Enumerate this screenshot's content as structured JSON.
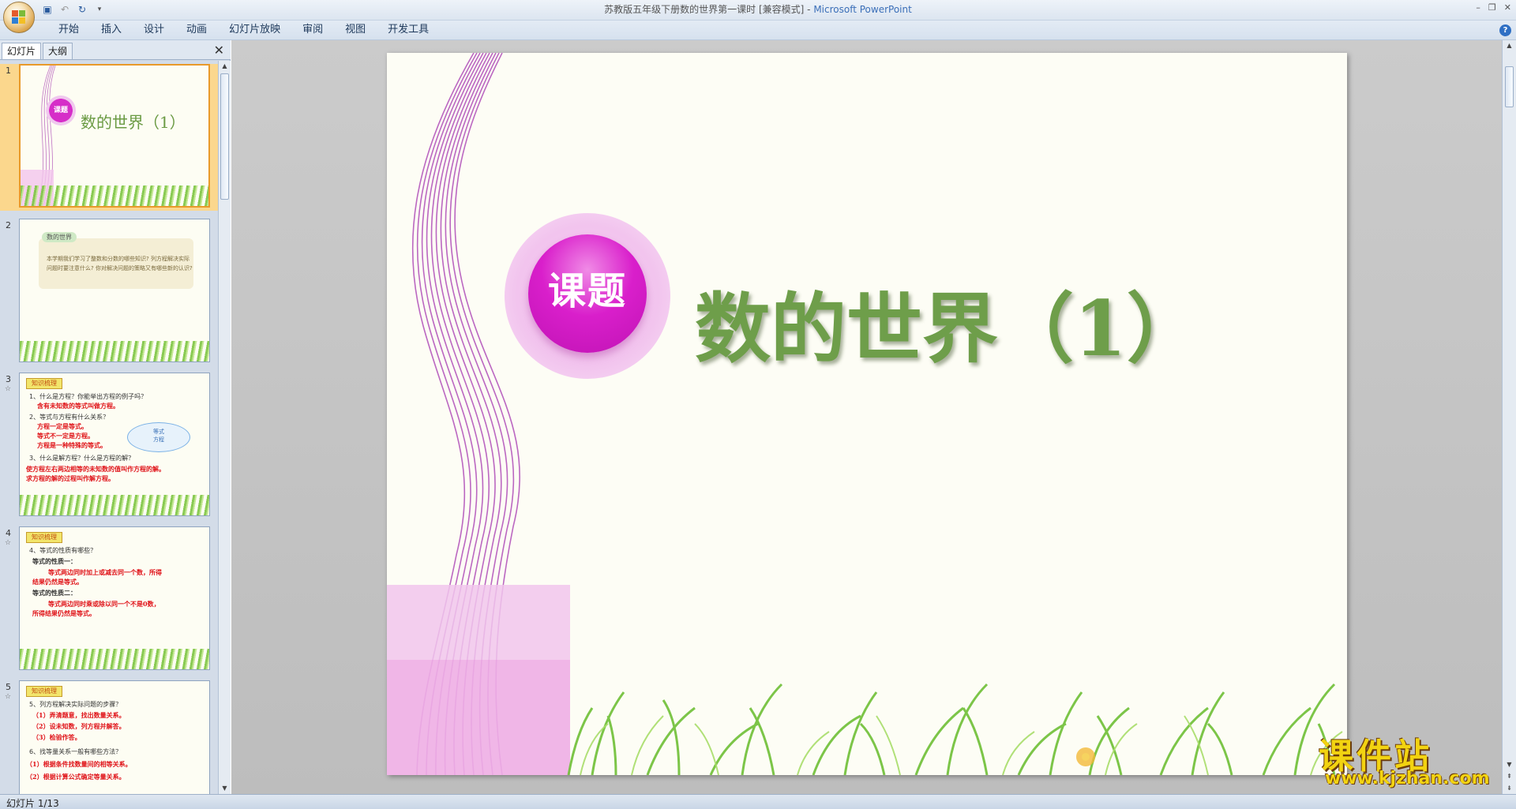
{
  "window": {
    "title": "苏教版五年级下册数的世界第一课时 [兼容模式] - ",
    "app_name": "Microsoft PowerPoint"
  },
  "ribbon": {
    "tabs": [
      "开始",
      "插入",
      "设计",
      "动画",
      "幻灯片放映",
      "审阅",
      "视图",
      "开发工具"
    ]
  },
  "panel": {
    "tab_slides": "幻灯片",
    "tab_outline": "大纲",
    "close": "✕"
  },
  "thumbnails": [
    {
      "num": "1",
      "title": "数的世界（1）",
      "badge": "课题"
    },
    {
      "num": "2",
      "tag": "数的世界",
      "text": "本学期我们学习了整数和分数的哪些知识? 列方程解决实际问题时要注意什么? 你对解决问题的策略又有哪些新的认识?"
    },
    {
      "num": "3",
      "tag": "知识梳理",
      "lines": [
        {
          "t": "1、什么是方程？你能举出方程的例子吗？",
          "red": false
        },
        {
          "t": "含有未知数的等式叫做方程。",
          "red": true
        },
        {
          "t": "2、等式与方程有什么关系？",
          "red": false
        },
        {
          "t": "方程一定是等式。",
          "red": true
        },
        {
          "t": "等式不一定是方程。",
          "red": true
        },
        {
          "t": "方程是一种特殊的等式。",
          "red": true
        },
        {
          "t": "3、什么是解方程？什么是方程的解？",
          "red": false
        },
        {
          "t": "使方程左右两边相等的未知数的值叫作方程的解。",
          "red": true
        },
        {
          "t": "求方程的解的过程叫作解方程。",
          "red": true
        }
      ],
      "ellipse_top": "等式",
      "ellipse_bottom": "方程"
    },
    {
      "num": "4",
      "tag": "知识梳理",
      "lines": [
        {
          "t": "4、等式的性质有哪些？",
          "red": false
        },
        {
          "t": "等式的性质一：",
          "red": false
        },
        {
          "t": "等式两边同时加上或减去同一个数，所得",
          "red": true
        },
        {
          "t": "结果仍然是等式。",
          "red": true
        },
        {
          "t": "等式的性质二：",
          "red": false
        },
        {
          "t": "等式两边同时乘或除以同一个不是0数，",
          "red": true
        },
        {
          "t": "所得结果仍然是等式。",
          "red": true
        }
      ]
    },
    {
      "num": "5",
      "tag": "知识梳理",
      "lines": [
        {
          "t": "5、列方程解决实际问题的步骤？",
          "red": false
        },
        {
          "t": "（1）弄清题意，找出数量关系。",
          "red": true
        },
        {
          "t": "（2）设未知数，列方程并解答。",
          "red": true
        },
        {
          "t": "（3）检验作答。",
          "red": true
        },
        {
          "t": "6、找等量关系一般有哪些方法？",
          "red": false
        },
        {
          "t": "（1）根据条件找数量间的相等关系。",
          "red": true
        },
        {
          "t": "（2）根据计算公式确定等量关系。",
          "red": true
        }
      ]
    }
  ],
  "slide": {
    "badge": "课题",
    "title": "数的世界（1）"
  },
  "status": {
    "slide_info": "幻灯片 1/13"
  },
  "watermark": {
    "name": "课件站",
    "url": "www.kjzhan.com"
  },
  "colors": {
    "title_green": "#6e9e4a",
    "badge_magenta": "#d91fcb",
    "ribbon_blue": "#1e395b",
    "selected_thumb": "#fbd78d"
  }
}
